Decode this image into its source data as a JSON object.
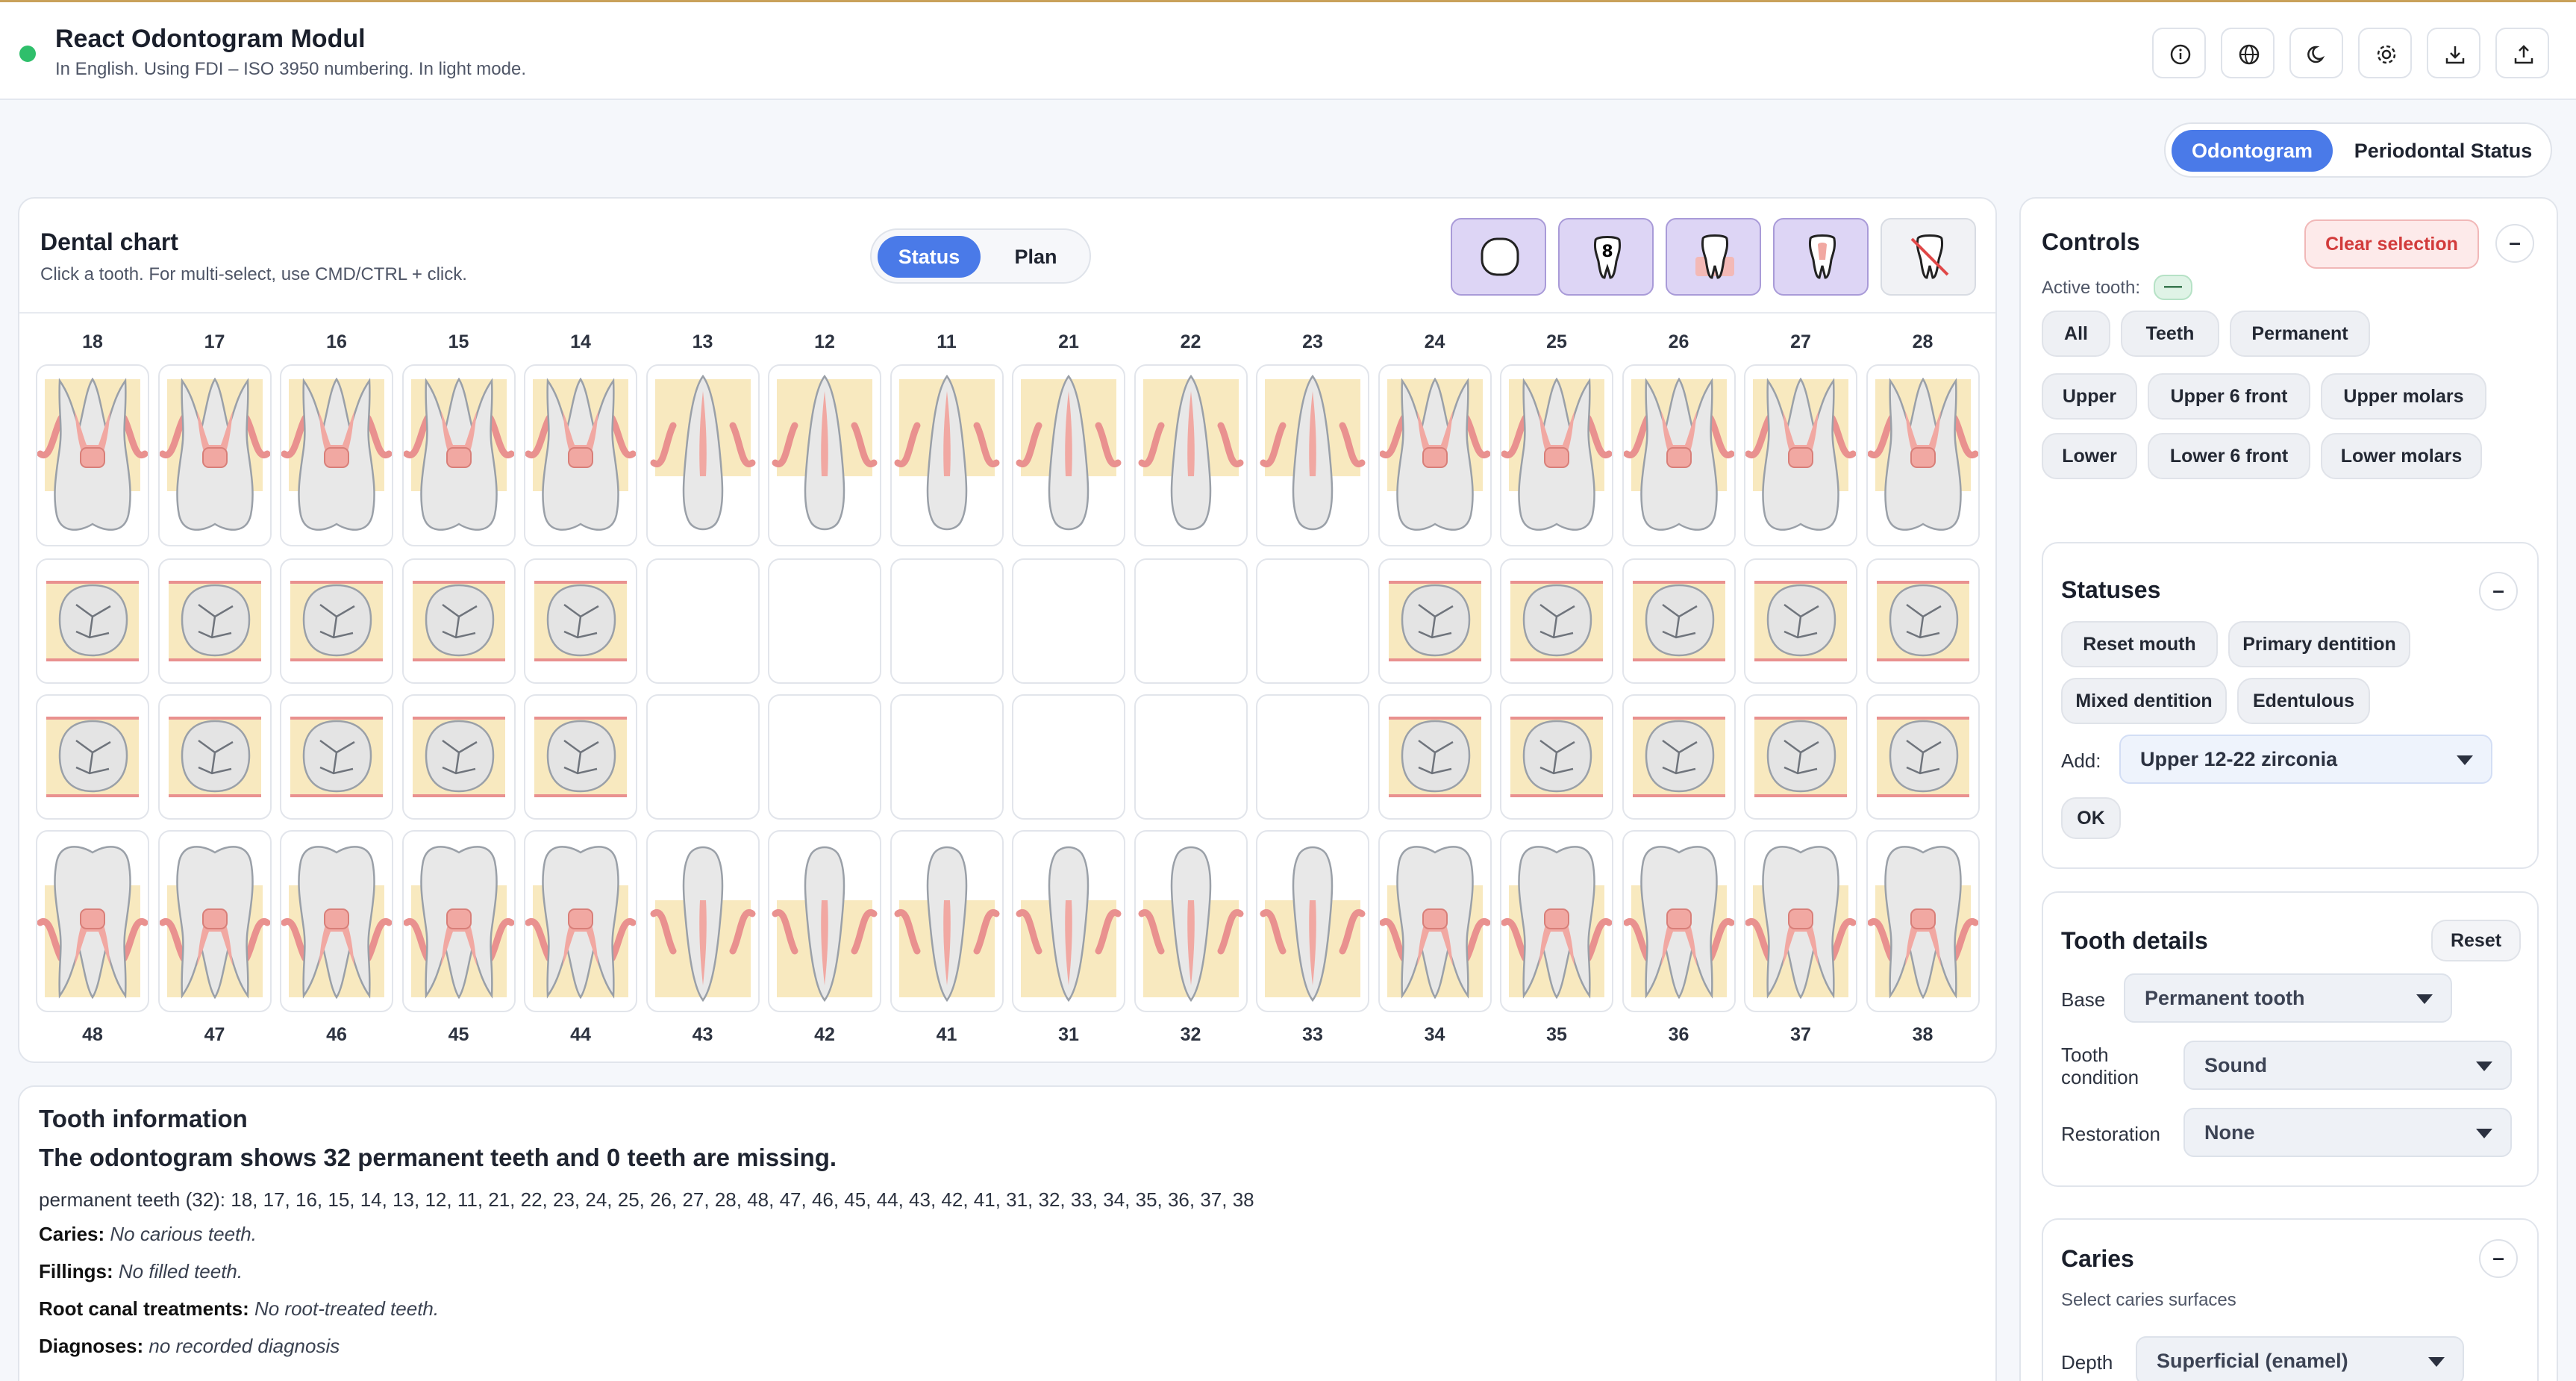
{
  "header": {
    "title": "React Odontogram Modul",
    "subtitle": "In English. Using FDI – ISO 3950 numbering. In light mode."
  },
  "toolbar": [
    "info-icon",
    "globe-icon",
    "moon-icon",
    "gear-icon",
    "download-icon",
    "upload-icon"
  ],
  "mode_tabs": {
    "odontogram": "Odontogram",
    "periodontal": "Periodontal Status",
    "active": "Odontogram"
  },
  "chart": {
    "title": "Dental chart",
    "hint": "Click a tooth. For multi-select, use CMD/CTRL + click.",
    "view_tabs": {
      "status": "Status",
      "plan": "Plan",
      "active": "Status"
    },
    "layers": [
      {
        "icon": "occlusal-outline-icon",
        "active": true
      },
      {
        "icon": "numbered-tooth-icon",
        "active": true
      },
      {
        "icon": "tooth-with-gum-icon",
        "active": true
      },
      {
        "icon": "tooth-with-pulp-icon",
        "active": true
      },
      {
        "icon": "crossed-tooth-icon",
        "active": false
      }
    ],
    "upper_numbers": [
      "18",
      "17",
      "16",
      "15",
      "14",
      "13",
      "12",
      "11",
      "21",
      "22",
      "23",
      "24",
      "25",
      "26",
      "27",
      "28"
    ],
    "lower_numbers": [
      "48",
      "47",
      "46",
      "45",
      "44",
      "43",
      "42",
      "41",
      "31",
      "32",
      "33",
      "34",
      "35",
      "36",
      "37",
      "38"
    ]
  },
  "info": {
    "title": "Tooth information",
    "summary": "The odontogram shows 32 permanent teeth and 0 teeth are missing.",
    "permanent_list": "permanent teeth (32): 18, 17, 16, 15, 14, 13, 12, 11, 21, 22, 23, 24, 25, 26, 27, 28, 48, 47, 46, 45, 44, 43, 42, 41, 31, 32, 33, 34, 35, 36, 37, 38",
    "caries_label": "Caries:",
    "caries_value": "No carious teeth.",
    "fillings_label": "Fillings:",
    "fillings_value": "No filled teeth.",
    "root_label": "Root canal treatments:",
    "root_value": "No root-treated teeth.",
    "diag_label": "Diagnoses:",
    "diag_value": "no recorded diagnosis"
  },
  "controls": {
    "title": "Controls",
    "clear": "Clear selection",
    "active_tooth_label": "Active tooth:",
    "active_tooth_value": "—",
    "row1": [
      "All",
      "Teeth",
      "Permanent"
    ],
    "row2": [
      "Upper",
      "Upper 6 front",
      "Upper molars"
    ],
    "row3": [
      "Lower",
      "Lower 6 front",
      "Lower molars"
    ]
  },
  "statuses": {
    "title": "Statuses",
    "reset": "Reset mouth",
    "primary": "Primary dentition",
    "mixed": "Mixed dentition",
    "edentulous": "Edentulous",
    "add_label": "Add:",
    "add_value": "Upper 12-22 zirconia",
    "ok": "OK"
  },
  "details": {
    "title": "Tooth details",
    "reset": "Reset",
    "base_label": "Base",
    "base_value": "Permanent tooth",
    "cond_label_1": "Tooth",
    "cond_label_2": "condition",
    "cond_value": "Sound",
    "rest_label": "Restoration",
    "rest_value": "None"
  },
  "caries": {
    "title": "Caries",
    "hint": "Select caries surfaces",
    "depth_label": "Depth",
    "depth_value": "Superficial (enamel)"
  },
  "colors": {
    "accent": "#4a7ae8",
    "root_band": "#f8e9bf",
    "gum": "#e9918f",
    "pulp": "#f1a8a2",
    "clear_red": "#d23b3b",
    "status_green": "#2fbf6b"
  }
}
